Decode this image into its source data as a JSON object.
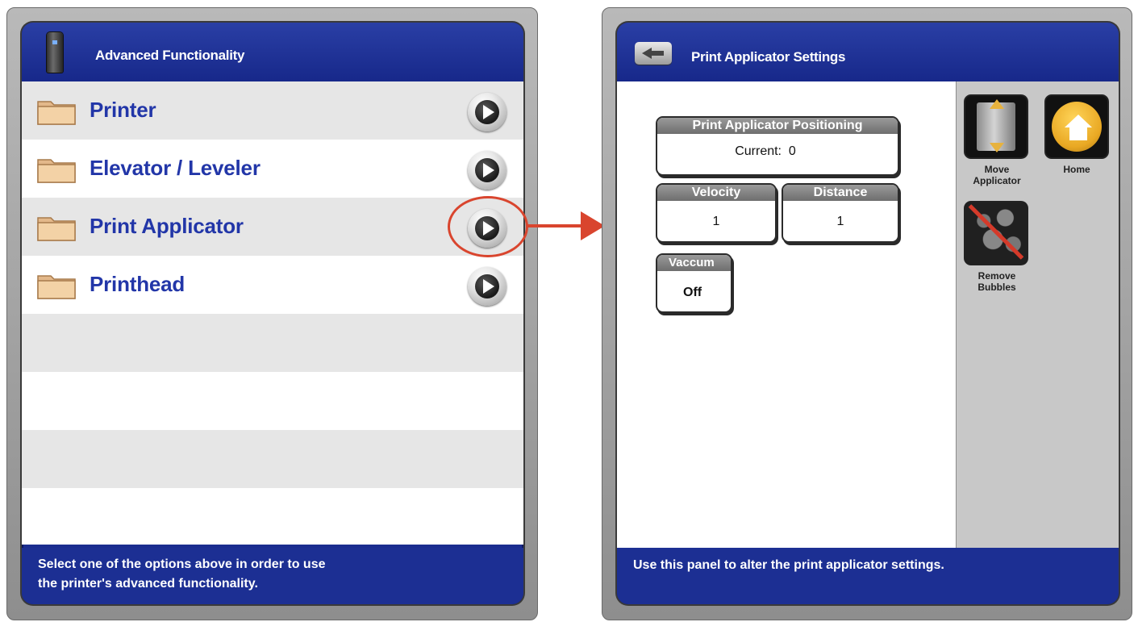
{
  "left_panel": {
    "header": {
      "title": "Advanced Functionality"
    },
    "menu_items": [
      {
        "label": "Printer"
      },
      {
        "label": "Elevator / Leveler"
      },
      {
        "label": "Print Applicator"
      },
      {
        "label": "Printhead"
      }
    ],
    "footer": {
      "line1": "Select one of the options above in order to use",
      "line2": "the printer's advanced functionality."
    }
  },
  "right_panel": {
    "header": {
      "title": "Print Applicator Settings"
    },
    "positioning": {
      "label": "Print Applicator Positioning",
      "value": "Current:  0"
    },
    "velocity": {
      "label": "Velocity",
      "value": "1"
    },
    "distance": {
      "label": "Distance",
      "value": "1"
    },
    "vacuum": {
      "label": "Vaccum",
      "value": "Off"
    },
    "side_buttons": {
      "move_line1": "Move",
      "move_line2": "Applicator",
      "home": "Home",
      "bubbles_line1": "Remove",
      "bubbles_line2": "Bubbles"
    },
    "footer": {
      "text": "Use this panel to alter the print applicator settings."
    }
  },
  "colors": {
    "accent_blue": "#1b2d8f",
    "label_blue": "#2236a8",
    "highlight_red": "#d9452e"
  }
}
